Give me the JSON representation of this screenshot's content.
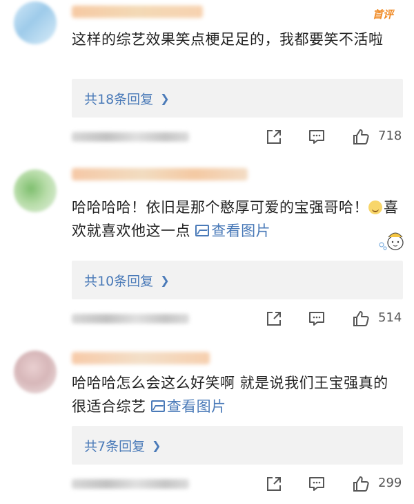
{
  "comments": [
    {
      "badge": "首评",
      "text": "这样的综艺效果笑点梗足足的，我都要笑不活啦",
      "reply_label": "共18条回复",
      "like_count": "718"
    },
    {
      "text_before_emoji": "哈哈哈哈！依旧是那个憨厚可爱的宝强哥哈！",
      "text_after_emoji": "喜欢就喜欢他这一点",
      "view_image_label": "查看图片",
      "reply_label": "共10条回复",
      "like_count": "514"
    },
    {
      "text": "哈哈哈怎么会这么好笑啊 就是说我们王宝强真的很适合综艺",
      "view_image_label": "查看图片",
      "reply_label": "共7条回复",
      "like_count": "299"
    }
  ],
  "icons": {
    "share": "share-icon",
    "comment": "comment-icon",
    "like": "thumbs-up-icon",
    "reply_chevron": "chevron-right-icon",
    "image": "image-icon"
  },
  "colors": {
    "link_blue": "#4a7ab8",
    "badge_orange": "#f08a24",
    "reply_bg": "#f2f2f2"
  }
}
